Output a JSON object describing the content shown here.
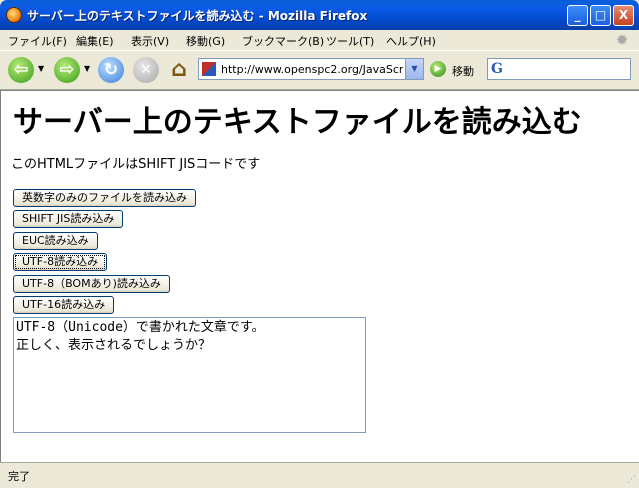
{
  "window": {
    "title": "サーバー上のテキストファイルを読み込む - Mozilla Firefox"
  },
  "window_buttons": {
    "minimize": "_",
    "maximize": "□",
    "close": "X"
  },
  "menu": [
    "ファイル(F)",
    "編集(E)",
    "表示(V)",
    "移動(G)",
    "ブックマーク(B)",
    "ツール(T)",
    "ヘルプ(H)"
  ],
  "nav": {
    "back": "⇦",
    "forward": "⇨",
    "reload": "↻",
    "stop": "✕",
    "home": "⌂",
    "url": "http://www.openspc2.org/JavaScri",
    "go_label": "移動",
    "search_value": ""
  },
  "page": {
    "heading": "サーバー上のテキストファイルを読み込む",
    "description": "このHTMLファイルはSHIFT JISコードです",
    "buttons": [
      "英数字のみのファイルを読み込み",
      "SHIFT JIS読み込み",
      "EUC読み込み",
      "UTF-8読み込み",
      "UTF-8（BOMあり)読み込み",
      "UTF-16読み込み"
    ],
    "textarea_value": "UTF-8（Unicode）で書かれた文章です。\n正しく、表示されるでしょうか？"
  },
  "status": {
    "text": "完了"
  }
}
